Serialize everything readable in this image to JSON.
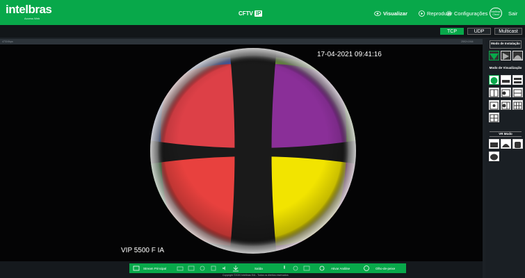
{
  "header": {
    "logo": "intelbras",
    "logo_sub": "Access Web",
    "brand": "CFTV",
    "brand_tag": "IP",
    "nav": {
      "visualizar": "Visualizar",
      "reproduzir": "Reproduzir",
      "configuracoes": "Configurações",
      "cloud": "Intelbras Cloud",
      "sair": "Sair"
    }
  },
  "protocol": {
    "tcp": "TCP",
    "udp": "UDP",
    "multicast": "Multicast",
    "selected": "TCP"
  },
  "stream_info": {
    "bitrate": "4731Kbps",
    "resolution": "2592×1944"
  },
  "video": {
    "timestamp": "17-04-2021 09:41:16",
    "camera_name": "VIP 5500 F IA"
  },
  "sidebar": {
    "install_mode_title": "Modo de Instalação",
    "view_mode_title": "Modo de Visualização",
    "vr_mode_title": "VR Modo"
  },
  "toolbar": {
    "main_stream": "Stream Principal",
    "output": "Saída",
    "enable_audio": "Ativar Análise",
    "fisheye": "Olho-de-peixe"
  },
  "footer": {
    "copyright": "Copyright ©2020 Intelbras S/A - Todos os direitos reservados"
  },
  "colors": {
    "accent": "#08a84a",
    "background": "#1c2126"
  }
}
